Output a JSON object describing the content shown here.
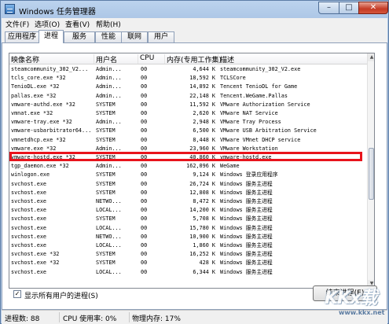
{
  "window": {
    "title": "Windows 任务管理器",
    "controls": {
      "minimize": "–",
      "maximize": "□",
      "close": "✕"
    }
  },
  "menu": [
    "文件(F)",
    "选项(O)",
    "查看(V)",
    "帮助(H)"
  ],
  "tabs": [
    {
      "label": "应用程序",
      "active": false
    },
    {
      "label": "进程",
      "active": true
    },
    {
      "label": "服务",
      "active": false
    },
    {
      "label": "性能",
      "active": false
    },
    {
      "label": "联网",
      "active": false
    },
    {
      "label": "用户",
      "active": false
    }
  ],
  "columns": {
    "name": "映像名称",
    "user": "用户名",
    "cpu": "CPU",
    "mem": "内存(专用工作集)",
    "desc": "描述"
  },
  "processes": [
    {
      "name": "steamcommunity_302_V2...",
      "user": "Admin...",
      "cpu": "00",
      "mem": "4,644 K",
      "desc": "steamcommunity_302_V2.exe"
    },
    {
      "name": "tcls_core.exe *32",
      "user": "Admin...",
      "cpu": "00",
      "mem": "18,592 K",
      "desc": "TCLSCore"
    },
    {
      "name": "TenioDL.exe *32",
      "user": "Admin...",
      "cpu": "00",
      "mem": "14,892 K",
      "desc": "Tencent TenioDL for Game"
    },
    {
      "name": "pallas.exe *32",
      "user": "Admin...",
      "cpu": "00",
      "mem": "22,148 K",
      "desc": "Tencent.WeGame.Pallas"
    },
    {
      "name": "vmware-authd.exe *32",
      "user": "SYSTEM",
      "cpu": "00",
      "mem": "11,592 K",
      "desc": "VMware Authorization Service"
    },
    {
      "name": "vmnat.exe *32",
      "user": "SYSTEM",
      "cpu": "00",
      "mem": "2,620 K",
      "desc": "VMware NAT Service"
    },
    {
      "name": "vmware-tray.exe *32",
      "user": "Admin...",
      "cpu": "00",
      "mem": "2,948 K",
      "desc": "VMware Tray Process"
    },
    {
      "name": "vmware-usbarbitrator64...",
      "user": "SYSTEM",
      "cpu": "00",
      "mem": "6,500 K",
      "desc": "VMware USB Arbitration Service"
    },
    {
      "name": "vmnetdhcp.exe *32",
      "user": "SYSTEM",
      "cpu": "00",
      "mem": "8,448 K",
      "desc": "VMware VMnet DHCP service"
    },
    {
      "name": "vmware.exe *32",
      "user": "Admin...",
      "cpu": "00",
      "mem": "23,960 K",
      "desc": "VMware Workstation"
    },
    {
      "name": "vmware-hostd.exe *32",
      "user": "SYSTEM",
      "cpu": "00",
      "mem": "40,860 K",
      "desc": "vmware-hostd.exe"
    },
    {
      "name": "tgp_daemon.exe *32",
      "user": "Admin...",
      "cpu": "00",
      "mem": "162,096 K",
      "desc": "WeGame"
    },
    {
      "name": "winlogon.exe",
      "user": "SYSTEM",
      "cpu": "00",
      "mem": "9,124 K",
      "desc": "Windows 登录应用程序"
    },
    {
      "name": "svchost.exe",
      "user": "SYSTEM",
      "cpu": "00",
      "mem": "26,724 K",
      "desc": "Windows 服务主进程"
    },
    {
      "name": "svchost.exe",
      "user": "SYSTEM",
      "cpu": "00",
      "mem": "12,808 K",
      "desc": "Windows 服务主进程"
    },
    {
      "name": "svchost.exe",
      "user": "NETWO...",
      "cpu": "00",
      "mem": "8,472 K",
      "desc": "Windows 服务主进程"
    },
    {
      "name": "svchost.exe",
      "user": "LOCAL...",
      "cpu": "00",
      "mem": "14,200 K",
      "desc": "Windows 服务主进程"
    },
    {
      "name": "svchost.exe",
      "user": "SYSTEM",
      "cpu": "00",
      "mem": "5,708 K",
      "desc": "Windows 服务主进程"
    },
    {
      "name": "svchost.exe",
      "user": "LOCAL...",
      "cpu": "00",
      "mem": "15,780 K",
      "desc": "Windows 服务主进程"
    },
    {
      "name": "svchost.exe",
      "user": "NETWO...",
      "cpu": "00",
      "mem": "10,900 K",
      "desc": "Windows 服务主进程"
    },
    {
      "name": "svchost.exe",
      "user": "LOCAL...",
      "cpu": "00",
      "mem": "1,860 K",
      "desc": "Windows 服务主进程"
    },
    {
      "name": "svchost.exe *32",
      "user": "SYSTEM",
      "cpu": "00",
      "mem": "16,252 K",
      "desc": "Windows 服务主进程"
    },
    {
      "name": "svchost.exe *32",
      "user": "SYSTEM",
      "cpu": "00",
      "mem": "428 K",
      "desc": "Windows 服务主进程"
    },
    {
      "name": "svchost.exe",
      "user": "LOCAL...",
      "cpu": "00",
      "mem": "6,344 K",
      "desc": "Windows 服务主进程"
    }
  ],
  "highlight": {
    "row_index": 10,
    "color": "#e8141c"
  },
  "show_all": {
    "label": "显示所有用户的进程(S)",
    "checked": true,
    "check_glyph": "✓"
  },
  "end_process_label": "结束进程(E)",
  "status": {
    "processes": "进程数: 88",
    "cpu": "CPU 使用率: 0%",
    "memory": "物理内存: 17%"
  },
  "watermark": {
    "logo": "KKx载",
    "url": "www.kkx.net"
  },
  "scrollbar": {
    "up": "▲",
    "down": "▼"
  }
}
